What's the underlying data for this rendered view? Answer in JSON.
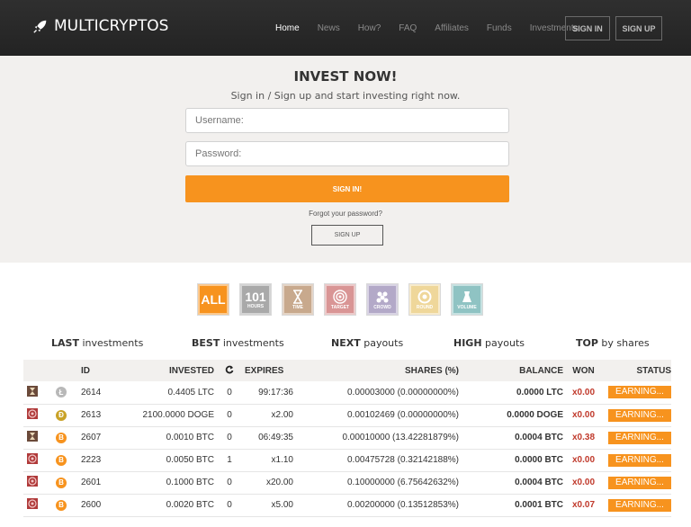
{
  "brand": {
    "name": "MULTICRYPTOS"
  },
  "nav": {
    "items": [
      "Home",
      "News",
      "How?",
      "FAQ",
      "Affiliates",
      "Funds",
      "Investments"
    ],
    "active": "Home"
  },
  "auth": {
    "signin": "SIGN IN",
    "signup": "SIGN UP"
  },
  "hero": {
    "title": "INVEST NOW!",
    "subtitle": "Sign in / Sign up and start investing right now.",
    "username_placeholder": "Username:",
    "password_placeholder": "Password:",
    "signin_button": "SIGN IN!",
    "forgot": "Forgot your password?",
    "signup_button": "SIGN UP"
  },
  "filters": [
    {
      "big": "ALL",
      "small": "",
      "color": "#f7931e",
      "icon": "all"
    },
    {
      "big": "101",
      "small": "HOURS",
      "color": "#a9a9a9",
      "icon": "hours"
    },
    {
      "big": "",
      "small": "TIME",
      "color": "#c8a98d",
      "icon": "hourglass-icon"
    },
    {
      "big": "",
      "small": "TARGET",
      "color": "#d99595",
      "icon": "target-icon"
    },
    {
      "big": "",
      "small": "CROWD",
      "color": "#b3a9c8",
      "icon": "crowd-icon"
    },
    {
      "big": "",
      "small": "ROUND",
      "color": "#efd79a",
      "icon": "round-icon"
    },
    {
      "big": "",
      "small": "VOLUME",
      "color": "#8fc3c3",
      "icon": "volume-icon"
    }
  ],
  "tabs": [
    {
      "bold": "LAST",
      "rest": " investments"
    },
    {
      "bold": "BEST",
      "rest": " investments"
    },
    {
      "bold": "NEXT",
      "rest": " payouts"
    },
    {
      "bold": "HIGH",
      "rest": " payouts"
    },
    {
      "bold": "TOP",
      "rest": " by shares"
    }
  ],
  "table": {
    "headers": [
      "ID",
      "INVESTED",
      "",
      "EXPIRES",
      "SHARES (%)",
      "BALANCE",
      "WON",
      "STATUS"
    ],
    "rows": [
      {
        "type": "time",
        "coin": "LTC",
        "id": "2614",
        "invested": "0.4405 LTC",
        "rounds": "0",
        "expires": "99:17:36",
        "shares": "0.00003000 (0.00000000%)",
        "balance": "0.0000 LTC",
        "won": "x0.00",
        "status": "EARNING..."
      },
      {
        "type": "target",
        "coin": "DOGE",
        "id": "2613",
        "invested": "2100.0000 DOGE",
        "rounds": "0",
        "expires": "x2.00",
        "shares": "0.00102469 (0.00000000%)",
        "balance": "0.0000 DOGE",
        "won": "x0.00",
        "status": "EARNING..."
      },
      {
        "type": "time",
        "coin": "BTC",
        "id": "2607",
        "invested": "0.0010 BTC",
        "rounds": "0",
        "expires": "06:49:35",
        "shares": "0.00010000 (13.42281879%)",
        "balance": "0.0004 BTC",
        "won": "x0.38",
        "status": "EARNING..."
      },
      {
        "type": "target",
        "coin": "BTC",
        "id": "2223",
        "invested": "0.0050 BTC",
        "rounds": "1",
        "expires": "x1.10",
        "shares": "0.00475728 (0.32142188%)",
        "balance": "0.0000 BTC",
        "won": "x0.00",
        "status": "EARNING..."
      },
      {
        "type": "target",
        "coin": "BTC",
        "id": "2601",
        "invested": "0.1000 BTC",
        "rounds": "0",
        "expires": "x20.00",
        "shares": "0.10000000 (6.75642632%)",
        "balance": "0.0004 BTC",
        "won": "x0.00",
        "status": "EARNING..."
      },
      {
        "type": "target",
        "coin": "BTC",
        "id": "2600",
        "invested": "0.0020 BTC",
        "rounds": "0",
        "expires": "x5.00",
        "shares": "0.00200000 (0.13512853%)",
        "balance": "0.0001 BTC",
        "won": "x0.07",
        "status": "EARNING..."
      }
    ]
  },
  "colors": {
    "accent": "#f7931e",
    "won": "#c0392b",
    "header_bg": "#2a2a2a",
    "hero_bg": "#f2f0ee",
    "ltc": "#b8b8b8",
    "btc": "#f7931e",
    "doge": "#c9a227"
  }
}
